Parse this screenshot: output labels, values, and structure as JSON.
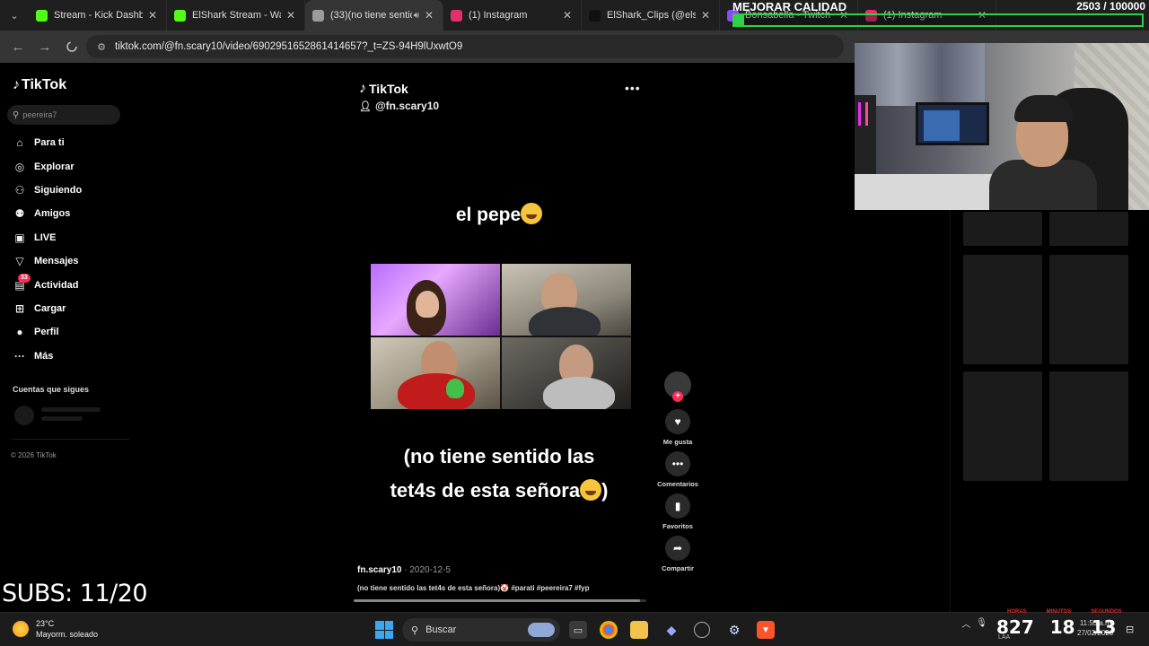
{
  "browser": {
    "tabs": [
      {
        "title": "Stream - Kick Dashboa",
        "fav_color": "#53fc18",
        "active": false
      },
      {
        "title": "ElShark Stream - Watc",
        "fav_color": "#53fc18",
        "active": false
      },
      {
        "title": "(33)(no tiene sentid",
        "fav_color": "#9b9b9b",
        "active": true
      },
      {
        "title": "(1) Instagram",
        "fav_color": "#e1306c",
        "active": false
      },
      {
        "title": "ElShark_Clips (@elsha",
        "fav_color": "#111111",
        "active": false
      },
      {
        "title": "Bonsabella - Twitch",
        "fav_color": "#9146ff",
        "active": false
      },
      {
        "title": "(1) Instagram",
        "fav_color": "#e1306c",
        "active": false
      }
    ],
    "url": "tiktok.com/@fn.scary10/video/6902951652861414657?_t=ZS-94H9lUxwtO9"
  },
  "overlay": {
    "quality_title": "MEJORAR CALIDAD",
    "quality_count": "2503  /  100000",
    "quality_progress": 0.025,
    "subs_text": "SUBS: 11/20",
    "timer_digits": [
      "827",
      "18",
      "13"
    ],
    "timer_labels": [
      "HORAS",
      "MINUTOS",
      "SEGUNDOS"
    ]
  },
  "sidebar": {
    "logo": "TikTok",
    "search_placeholder": "peereira7",
    "items": [
      {
        "label": "Para ti",
        "icon": "home-icon",
        "glyph": "⌂"
      },
      {
        "label": "Explorar",
        "icon": "compass-icon",
        "glyph": "◎"
      },
      {
        "label": "Siguiendo",
        "icon": "following-icon",
        "glyph": "⚇"
      },
      {
        "label": "Amigos",
        "icon": "friends-icon",
        "glyph": "⚉"
      },
      {
        "label": "LIVE",
        "icon": "live-icon",
        "glyph": "▣"
      },
      {
        "label": "Mensajes",
        "icon": "messages-icon",
        "glyph": "▽"
      },
      {
        "label": "Actividad",
        "icon": "activity-icon",
        "glyph": "▤",
        "badge": "33"
      },
      {
        "label": "Cargar",
        "icon": "upload-icon",
        "glyph": "⊞"
      },
      {
        "label": "Perfil",
        "icon": "profile-icon",
        "glyph": "●"
      },
      {
        "label": "Más",
        "icon": "more-icon",
        "glyph": "···"
      }
    ],
    "following_title": "Cuentas que sigues",
    "copyright": "© 2026 TikTok"
  },
  "video": {
    "brand": "TikTok",
    "handle": "@fn.scary10",
    "caption_top": "el pepe",
    "caption_bottom_line1": "(no tiene sentido las",
    "caption_bottom_line2": "tet4s de esta señora",
    "author": "fn.scary10",
    "date": "2020-12-5",
    "description": "(no tiene sentido las tet4s de esta señora)🤡 #parati #peereira7 #fyp",
    "progress": 0.98,
    "actions": [
      {
        "label": "Me gusta",
        "icon": "heart-icon",
        "glyph": "♥"
      },
      {
        "label": "Comentarios",
        "icon": "comment-icon",
        "glyph": "•••"
      },
      {
        "label": "Favoritos",
        "icon": "bookmark-icon",
        "glyph": "▮"
      },
      {
        "label": "Compartir",
        "icon": "share-icon",
        "glyph": "➦"
      }
    ]
  },
  "taskbar": {
    "temperature": "23°C",
    "weather": "Mayorm. soleado",
    "search_label": "Buscar",
    "time": "11:53 a.m.",
    "date": "27/02/2026",
    "lang": "LAA"
  }
}
